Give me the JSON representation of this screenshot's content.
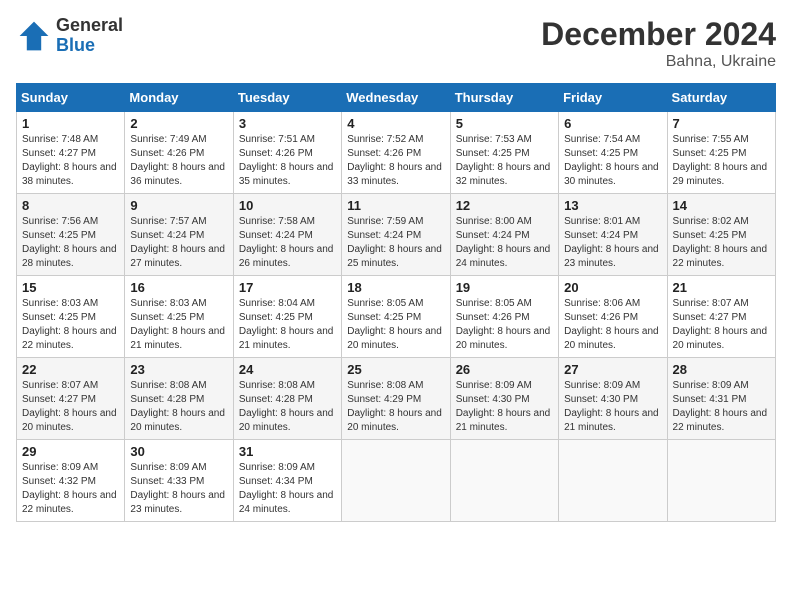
{
  "header": {
    "logo_line1": "General",
    "logo_line2": "Blue",
    "month": "December 2024",
    "location": "Bahna, Ukraine"
  },
  "days_of_week": [
    "Sunday",
    "Monday",
    "Tuesday",
    "Wednesday",
    "Thursday",
    "Friday",
    "Saturday"
  ],
  "weeks": [
    [
      {
        "day": "1",
        "sunrise": "7:48 AM",
        "sunset": "4:27 PM",
        "daylight": "8 hours and 38 minutes."
      },
      {
        "day": "2",
        "sunrise": "7:49 AM",
        "sunset": "4:26 PM",
        "daylight": "8 hours and 36 minutes."
      },
      {
        "day": "3",
        "sunrise": "7:51 AM",
        "sunset": "4:26 PM",
        "daylight": "8 hours and 35 minutes."
      },
      {
        "day": "4",
        "sunrise": "7:52 AM",
        "sunset": "4:26 PM",
        "daylight": "8 hours and 33 minutes."
      },
      {
        "day": "5",
        "sunrise": "7:53 AM",
        "sunset": "4:25 PM",
        "daylight": "8 hours and 32 minutes."
      },
      {
        "day": "6",
        "sunrise": "7:54 AM",
        "sunset": "4:25 PM",
        "daylight": "8 hours and 30 minutes."
      },
      {
        "day": "7",
        "sunrise": "7:55 AM",
        "sunset": "4:25 PM",
        "daylight": "8 hours and 29 minutes."
      }
    ],
    [
      {
        "day": "8",
        "sunrise": "7:56 AM",
        "sunset": "4:25 PM",
        "daylight": "8 hours and 28 minutes."
      },
      {
        "day": "9",
        "sunrise": "7:57 AM",
        "sunset": "4:24 PM",
        "daylight": "8 hours and 27 minutes."
      },
      {
        "day": "10",
        "sunrise": "7:58 AM",
        "sunset": "4:24 PM",
        "daylight": "8 hours and 26 minutes."
      },
      {
        "day": "11",
        "sunrise": "7:59 AM",
        "sunset": "4:24 PM",
        "daylight": "8 hours and 25 minutes."
      },
      {
        "day": "12",
        "sunrise": "8:00 AM",
        "sunset": "4:24 PM",
        "daylight": "8 hours and 24 minutes."
      },
      {
        "day": "13",
        "sunrise": "8:01 AM",
        "sunset": "4:24 PM",
        "daylight": "8 hours and 23 minutes."
      },
      {
        "day": "14",
        "sunrise": "8:02 AM",
        "sunset": "4:25 PM",
        "daylight": "8 hours and 22 minutes."
      }
    ],
    [
      {
        "day": "15",
        "sunrise": "8:03 AM",
        "sunset": "4:25 PM",
        "daylight": "8 hours and 22 minutes."
      },
      {
        "day": "16",
        "sunrise": "8:03 AM",
        "sunset": "4:25 PM",
        "daylight": "8 hours and 21 minutes."
      },
      {
        "day": "17",
        "sunrise": "8:04 AM",
        "sunset": "4:25 PM",
        "daylight": "8 hours and 21 minutes."
      },
      {
        "day": "18",
        "sunrise": "8:05 AM",
        "sunset": "4:25 PM",
        "daylight": "8 hours and 20 minutes."
      },
      {
        "day": "19",
        "sunrise": "8:05 AM",
        "sunset": "4:26 PM",
        "daylight": "8 hours and 20 minutes."
      },
      {
        "day": "20",
        "sunrise": "8:06 AM",
        "sunset": "4:26 PM",
        "daylight": "8 hours and 20 minutes."
      },
      {
        "day": "21",
        "sunrise": "8:07 AM",
        "sunset": "4:27 PM",
        "daylight": "8 hours and 20 minutes."
      }
    ],
    [
      {
        "day": "22",
        "sunrise": "8:07 AM",
        "sunset": "4:27 PM",
        "daylight": "8 hours and 20 minutes."
      },
      {
        "day": "23",
        "sunrise": "8:08 AM",
        "sunset": "4:28 PM",
        "daylight": "8 hours and 20 minutes."
      },
      {
        "day": "24",
        "sunrise": "8:08 AM",
        "sunset": "4:28 PM",
        "daylight": "8 hours and 20 minutes."
      },
      {
        "day": "25",
        "sunrise": "8:08 AM",
        "sunset": "4:29 PM",
        "daylight": "8 hours and 20 minutes."
      },
      {
        "day": "26",
        "sunrise": "8:09 AM",
        "sunset": "4:30 PM",
        "daylight": "8 hours and 21 minutes."
      },
      {
        "day": "27",
        "sunrise": "8:09 AM",
        "sunset": "4:30 PM",
        "daylight": "8 hours and 21 minutes."
      },
      {
        "day": "28",
        "sunrise": "8:09 AM",
        "sunset": "4:31 PM",
        "daylight": "8 hours and 22 minutes."
      }
    ],
    [
      {
        "day": "29",
        "sunrise": "8:09 AM",
        "sunset": "4:32 PM",
        "daylight": "8 hours and 22 minutes."
      },
      {
        "day": "30",
        "sunrise": "8:09 AM",
        "sunset": "4:33 PM",
        "daylight": "8 hours and 23 minutes."
      },
      {
        "day": "31",
        "sunrise": "8:09 AM",
        "sunset": "4:34 PM",
        "daylight": "8 hours and 24 minutes."
      },
      null,
      null,
      null,
      null
    ]
  ],
  "labels": {
    "sunrise": "Sunrise:",
    "sunset": "Sunset:",
    "daylight": "Daylight:"
  }
}
